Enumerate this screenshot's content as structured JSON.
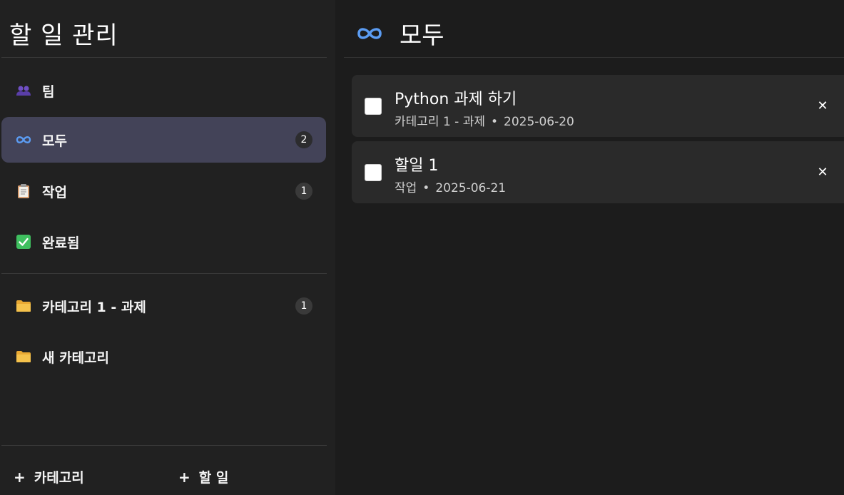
{
  "sidebar": {
    "title": "할 일 관리",
    "nav": [
      {
        "label": "팀",
        "icon": "team-icon",
        "count": ""
      },
      {
        "label": "모두",
        "icon": "infinity-icon",
        "count": "2"
      },
      {
        "label": "작업",
        "icon": "clipboard-icon",
        "count": "1"
      },
      {
        "label": "완료됨",
        "icon": "check-box-icon",
        "count": ""
      }
    ],
    "categories": [
      {
        "label": "카테고리 1 - 과제",
        "icon": "folder-icon",
        "count": "1"
      },
      {
        "label": "새 카테고리",
        "icon": "folder-icon",
        "count": ""
      }
    ],
    "add_category_label": "카테고리",
    "add_task_label": "할 일"
  },
  "main": {
    "title": "모두",
    "icon": "infinity-icon",
    "tasks": [
      {
        "title": "Python 과제 하기",
        "category": "카테고리 1 - 과제",
        "date": "2025-06-20",
        "done": false
      },
      {
        "title": "할일 1",
        "category": "작업",
        "date": "2025-06-21",
        "done": false
      }
    ]
  },
  "colors": {
    "sidebar_bg": "#212121",
    "main_bg": "#1c1c1c",
    "active_item": "#434358",
    "card_bg": "#2a2a2a",
    "accent_blue": "#5b9cf2",
    "folder_yellow": "#f5c24c",
    "check_green": "#3fbf5f"
  }
}
